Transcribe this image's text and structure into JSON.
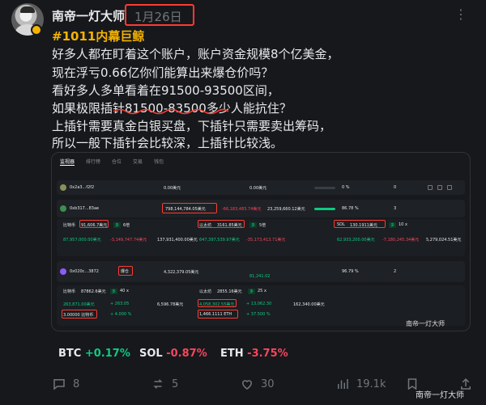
{
  "post": {
    "author": "南帝一灯大师",
    "date": "1月26日",
    "hashtag": "#1011内幕巨鲸",
    "lines": [
      "好多人都在盯着这个账户，账户资金规模8个亿美金，",
      "现在浮亏0.66亿你们能算出来爆仓价吗？",
      "看好多人多单看着在91500-93500区间，",
      "如果极限插针81500-83500多少人能抗住？",
      "上插针需要真金白银买盘，下插针只需要卖出筹码，",
      "所以一般下插针会比较深，上插针比较浅。"
    ]
  },
  "screenshot": {
    "tabs": [
      "监视器",
      "排行榜",
      "仓位",
      "交易",
      "钱包"
    ],
    "rows": [
      {
        "address": "0x2a3...f2f2",
        "value1": "0.00美元",
        "value2": "0.00美元",
        "pct": "0 %",
        "count": "0"
      },
      {
        "address": "0xb317...83ae",
        "value1": "798,144,784.05美元",
        "value2": "-66,183,483.74美元",
        "value3": "23,259,660.12美元",
        "pct": "86.78 %",
        "count": "3"
      },
      {
        "address": "0x020c...3872",
        "value1": "4,322,379.05美元",
        "pct": "96.79 %",
        "count": "2"
      }
    ],
    "positions": [
      {
        "coin": "比特币",
        "size": "91,606.7美元",
        "side": "多",
        "lev": "6倍"
      },
      {
        "coin": "以太坊",
        "size": "3161.85美元",
        "side": "多",
        "lev": "5倍"
      },
      {
        "coin": "SOL",
        "size": "130.1911美元",
        "side": "多",
        "lev": "10 x"
      },
      {
        "coin": "比特币",
        "size": "87862.6美元",
        "side": "多",
        "lev": "40 x"
      },
      {
        "coin": "以太坊",
        "size": "2855.16美元",
        "side": "多",
        "lev": "25 x"
      }
    ],
    "flag": "爆仓",
    "extra1": "3.00000 比特币",
    "extra2": "1,466.1111 ETH",
    "watermark": "南帝一灯大师"
  },
  "tickers": [
    {
      "symbol": "BTC",
      "change": "+0.17%",
      "dir": "up"
    },
    {
      "symbol": "SOL",
      "change": "-0.87%",
      "dir": "down"
    },
    {
      "symbol": "ETH",
      "change": "-3.75%",
      "dir": "down"
    }
  ],
  "actions": {
    "replies": "8",
    "reposts": "5",
    "likes": "30",
    "views": "19.1k"
  },
  "signature": "南帝一灯大师",
  "colors": {
    "accent": "#f5b301",
    "up": "#0ecb81",
    "down": "#f6465d",
    "highlight": "#ff3b30"
  }
}
